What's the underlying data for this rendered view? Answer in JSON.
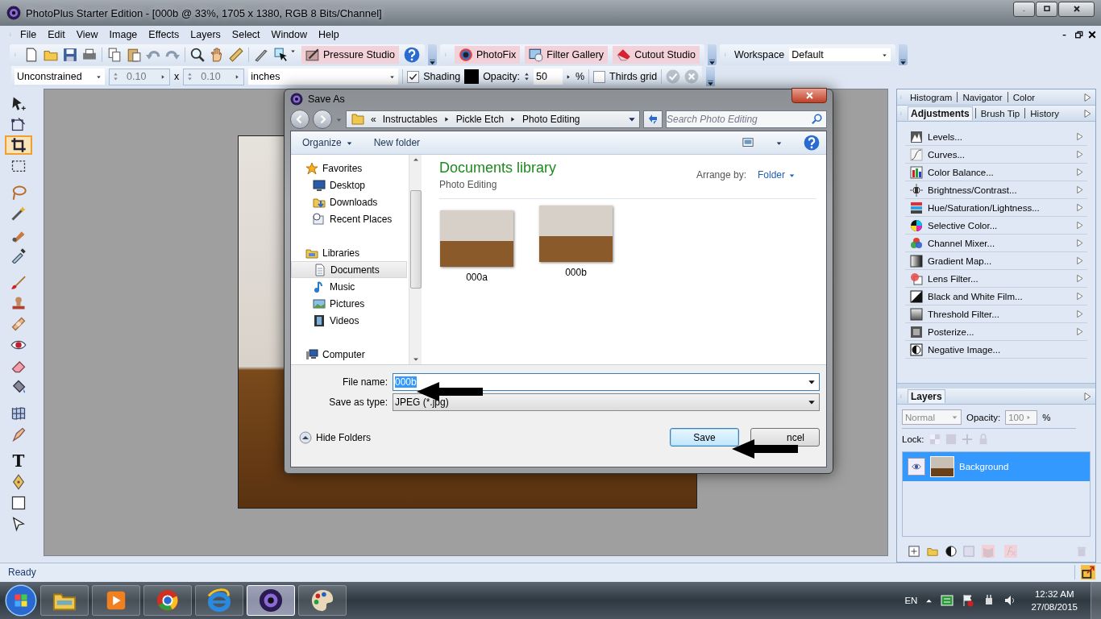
{
  "window": {
    "title": "PhotoPlus Starter Edition - [000b @ 33%, 1705 x 1380, RGB 8 Bits/Channel]"
  },
  "menu": [
    {
      "label": "File"
    },
    {
      "label": "Edit"
    },
    {
      "label": "View"
    },
    {
      "label": "Image"
    },
    {
      "label": "Effects"
    },
    {
      "label": "Layers"
    },
    {
      "label": "Select"
    },
    {
      "label": "Window"
    },
    {
      "label": "Help"
    }
  ],
  "toolbar": {
    "studio_buttons": [
      {
        "label": "Pressure Studio"
      }
    ],
    "fix_buttons": [
      {
        "label": "PhotoFix",
        "kind": "photofix"
      },
      {
        "label": "Filter Gallery",
        "kind": "gallery"
      },
      {
        "label": "Cutout Studio",
        "kind": "cutout"
      }
    ],
    "workspace": {
      "label": "Workspace",
      "value": "Default"
    }
  },
  "context_bar": {
    "ratio": "Unconstrained",
    "width": {
      "value": "0.10",
      "disabled": true
    },
    "by": "x",
    "height": {
      "value": "0.10",
      "disabled": true
    },
    "units": "inches",
    "shading": {
      "label": "Shading",
      "checked": true
    },
    "opacity_label": "Opacity:",
    "opacity": "50",
    "percent": "%",
    "thirds_grid": {
      "label": "Thirds grid",
      "checked": false
    }
  },
  "tools": [
    {
      "kind": "move",
      "selected": false
    },
    {
      "kind": "deform",
      "selected": false
    },
    {
      "kind": "crop",
      "selected": true
    },
    {
      "kind": "marquee",
      "selected": false
    },
    {
      "kind": "lasso",
      "selected": false
    },
    {
      "kind": "wand",
      "selected": false
    },
    {
      "kind": "smudge",
      "selected": false
    },
    {
      "kind": "dropper",
      "selected": false
    },
    {
      "kind": "brush",
      "selected": false
    },
    {
      "kind": "stamp",
      "selected": false
    },
    {
      "kind": "patch",
      "selected": false
    },
    {
      "kind": "redeye",
      "selected": false
    },
    {
      "kind": "eraser",
      "selected": false
    },
    {
      "kind": "fill",
      "selected": false
    },
    {
      "kind": "warp",
      "selected": false
    },
    {
      "kind": "retouch",
      "selected": false
    },
    {
      "kind": "text",
      "label": "T",
      "selected": false
    },
    {
      "kind": "pen",
      "selected": false
    },
    {
      "kind": "shape",
      "selected": false
    },
    {
      "kind": "node",
      "selected": false
    }
  ],
  "dialog": {
    "title": "Save As",
    "breadcrumb_overflow": "«",
    "breadcrumb": [
      "Instructables",
      "Pickle Etch",
      "Photo Editing"
    ],
    "search": {
      "placeholder": "Search Photo Editing"
    },
    "commands": [
      {
        "label": "Organize",
        "menu": true
      },
      {
        "label": "New folder",
        "menu": false
      }
    ],
    "nav": [
      {
        "label": "Favorites",
        "kind": "star",
        "selected": false,
        "children": [
          {
            "label": "Desktop",
            "kind": "desktop",
            "selected": false
          },
          {
            "label": "Downloads",
            "kind": "downloads",
            "selected": false
          },
          {
            "label": "Recent Places",
            "kind": "recent",
            "selected": false
          }
        ]
      },
      {
        "label": "Libraries",
        "kind": "library",
        "selected": false,
        "children": [
          {
            "label": "Documents",
            "kind": "documents",
            "selected": true
          },
          {
            "label": "Music",
            "kind": "music",
            "selected": false
          },
          {
            "label": "Pictures",
            "kind": "pictures",
            "selected": false
          },
          {
            "label": "Videos",
            "kind": "videos",
            "selected": false
          }
        ]
      },
      {
        "label": "Computer",
        "kind": "computer",
        "selected": false
      }
    ],
    "library_title": "Documents library",
    "library_subtitle": "Photo Editing",
    "arrange_label": "Arrange by:",
    "arrange_value": "Folder",
    "files": [
      {
        "name": "000a"
      },
      {
        "name": "000b"
      }
    ],
    "file_name": {
      "label": "File name:",
      "value": "000b",
      "value_selected": true
    },
    "file_type": {
      "label": "Save as type:",
      "value": "JPEG (*.jpg)"
    },
    "hide_folders": "Hide Folders",
    "save": "Save",
    "cancel": "ncel"
  },
  "panels": {
    "top_tabs": [
      {
        "label": "Histogram",
        "selected": false
      },
      {
        "label": "Navigator",
        "selected": false
      },
      {
        "label": "Color",
        "selected": false
      }
    ],
    "tabs": [
      {
        "label": "Adjustments",
        "selected": true
      },
      {
        "label": "Brush Tip",
        "selected": false
      },
      {
        "label": "History",
        "selected": false
      }
    ],
    "adjustments": [
      {
        "label": "Levels...",
        "kind": "levels",
        "submenu": true
      },
      {
        "label": "Curves...",
        "kind": "curves",
        "submenu": true
      },
      {
        "label": "Color Balance...",
        "kind": "balance",
        "submenu": true
      },
      {
        "label": "Brightness/Contrast...",
        "kind": "brightness",
        "submenu": true
      },
      {
        "label": "Hue/Saturation/Lightness...",
        "kind": "hue",
        "submenu": true
      },
      {
        "label": "Selective Color...",
        "kind": "selective",
        "submenu": true
      },
      {
        "label": "Channel Mixer...",
        "kind": "mixer",
        "submenu": true
      },
      {
        "label": "Gradient Map...",
        "kind": "gradient",
        "submenu": true
      },
      {
        "label": "Lens Filter...",
        "kind": "lens",
        "submenu": true
      },
      {
        "label": "Black and White Film...",
        "kind": "bw",
        "submenu": true
      },
      {
        "label": "Threshold Filter...",
        "kind": "threshold",
        "submenu": true
      },
      {
        "label": "Posterize...",
        "kind": "posterize",
        "submenu": true
      },
      {
        "label": "Negative Image...",
        "kind": "negative",
        "submenu": false
      }
    ],
    "layers": {
      "tab": "Layers",
      "blend_mode": {
        "value": "Normal",
        "disabled": true
      },
      "opacity_label": "Opacity:",
      "opacity": {
        "value": "100",
        "disabled": true
      },
      "percent": "%",
      "lock_label": "Lock:",
      "items": [
        {
          "name": "Background",
          "selected": true,
          "visible": true
        }
      ]
    }
  },
  "status_bar": {
    "text": "Ready"
  },
  "taskbar": {
    "apps": [
      {
        "kind": "files",
        "selected": false
      },
      {
        "kind": "player",
        "selected": false
      },
      {
        "kind": "browser",
        "selected": false
      },
      {
        "kind": "explorer",
        "selected": false
      },
      {
        "kind": "photoplus",
        "selected": true
      },
      {
        "kind": "paint",
        "selected": false
      }
    ],
    "language": "EN",
    "time": "12:32 AM",
    "date": "27/08/2015"
  }
}
